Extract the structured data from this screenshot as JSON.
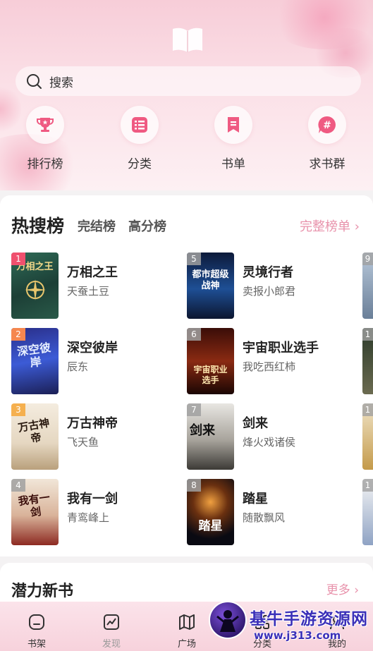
{
  "search": {
    "label": "搜索"
  },
  "quick_actions": [
    {
      "label": "排行榜",
      "icon": "trophy-icon"
    },
    {
      "label": "分类",
      "icon": "category-list-icon"
    },
    {
      "label": "书单",
      "icon": "bookmark-icon"
    },
    {
      "label": "求书群",
      "icon": "hashtag-icon"
    }
  ],
  "hot": {
    "title": "热搜榜",
    "tabs": [
      "完结榜",
      "高分榜"
    ],
    "more": "完整榜单 ›",
    "books": [
      {
        "rank": "1",
        "title": "万相之王",
        "author": "天蚕土豆",
        "cover_text": "万相之王"
      },
      {
        "rank": "2",
        "title": "深空彼岸",
        "author": "辰东",
        "cover_text": "深空彼岸"
      },
      {
        "rank": "3",
        "title": "万古神帝",
        "author": "飞天鱼",
        "cover_text": "万古神帝"
      },
      {
        "rank": "4",
        "title": "我有一剑",
        "author": "青鸾峰上",
        "cover_text": "我有一剑"
      },
      {
        "rank": "5",
        "title": "灵境行者",
        "author": "卖报小郎君",
        "cover_text": "都市超级战神"
      },
      {
        "rank": "6",
        "title": "宇宙职业选手",
        "author": "我吃西红柿",
        "cover_text": "宇宙职业选手"
      },
      {
        "rank": "7",
        "title": "剑来",
        "author": "烽火戏诸侯",
        "cover_text": "剑来"
      },
      {
        "rank": "8",
        "title": "踏星",
        "author": "随散飘风",
        "cover_text": "踏星"
      }
    ],
    "peek_ranks": [
      "9",
      "1",
      "1",
      "1"
    ]
  },
  "new_books": {
    "title": "潜力新书",
    "more": "更多 ›"
  },
  "nav": [
    {
      "label": "书架",
      "icon": "bookshelf-icon"
    },
    {
      "label": "发现",
      "icon": "trend-chart-icon"
    },
    {
      "label": "广场",
      "icon": "map-icon"
    },
    {
      "label": "分类",
      "icon": "category-icon"
    },
    {
      "label": "我的",
      "icon": "profile-icon"
    }
  ],
  "watermark": {
    "text": "基牛手游资源网",
    "url": "www.j313.com"
  },
  "colors": {
    "accent": "#e892ab",
    "header_pink": "#f7cdd8",
    "icon_pink": "#ef5a82"
  }
}
